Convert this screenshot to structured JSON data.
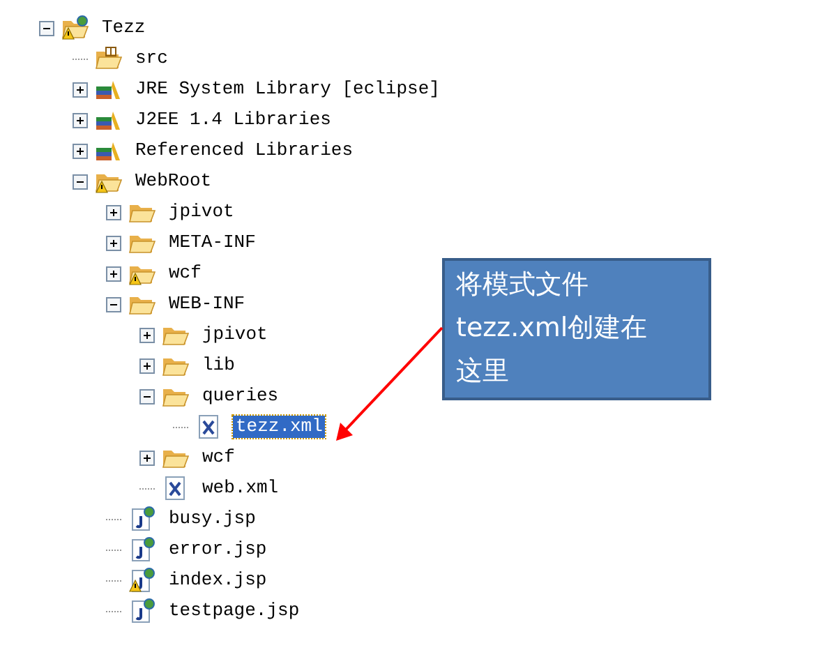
{
  "tree": [
    {
      "label": "Tezz",
      "kind": "project",
      "expanded": true,
      "selected": false,
      "children": [
        {
          "label": "src",
          "kind": "source-folder",
          "selected": false
        },
        {
          "label": "JRE System Library [eclipse]",
          "kind": "library",
          "expanded": false,
          "selected": false
        },
        {
          "label": "J2EE 1.4 Libraries",
          "kind": "library",
          "expanded": false,
          "selected": false
        },
        {
          "label": "Referenced Libraries",
          "kind": "library",
          "expanded": false,
          "selected": false
        },
        {
          "label": "WebRoot",
          "kind": "folder-warning",
          "expanded": true,
          "selected": false,
          "children": [
            {
              "label": "jpivot",
              "kind": "folder",
              "expanded": false,
              "selected": false
            },
            {
              "label": "META-INF",
              "kind": "folder",
              "expanded": false,
              "selected": false
            },
            {
              "label": "wcf",
              "kind": "folder-warning",
              "expanded": false,
              "selected": false
            },
            {
              "label": "WEB-INF",
              "kind": "folder",
              "expanded": true,
              "selected": false,
              "children": [
                {
                  "label": "jpivot",
                  "kind": "folder",
                  "expanded": false,
                  "selected": false
                },
                {
                  "label": "lib",
                  "kind": "folder",
                  "expanded": false,
                  "selected": false
                },
                {
                  "label": "queries",
                  "kind": "folder",
                  "expanded": true,
                  "selected": false,
                  "children": [
                    {
                      "label": "tezz.xml",
                      "kind": "xml",
                      "selected": true
                    }
                  ]
                },
                {
                  "label": "wcf",
                  "kind": "folder",
                  "expanded": false,
                  "selected": false
                },
                {
                  "label": "web.xml",
                  "kind": "xml",
                  "selected": false
                }
              ]
            },
            {
              "label": "busy.jsp",
              "kind": "jsp",
              "selected": false
            },
            {
              "label": "error.jsp",
              "kind": "jsp",
              "selected": false
            },
            {
              "label": "index.jsp",
              "kind": "jsp-warning",
              "selected": false
            },
            {
              "label": "testpage.jsp",
              "kind": "jsp",
              "selected": false
            }
          ]
        }
      ]
    }
  ],
  "callout": {
    "lines": [
      "将模式文件",
      "tezz.xml创建在",
      "这里"
    ]
  }
}
